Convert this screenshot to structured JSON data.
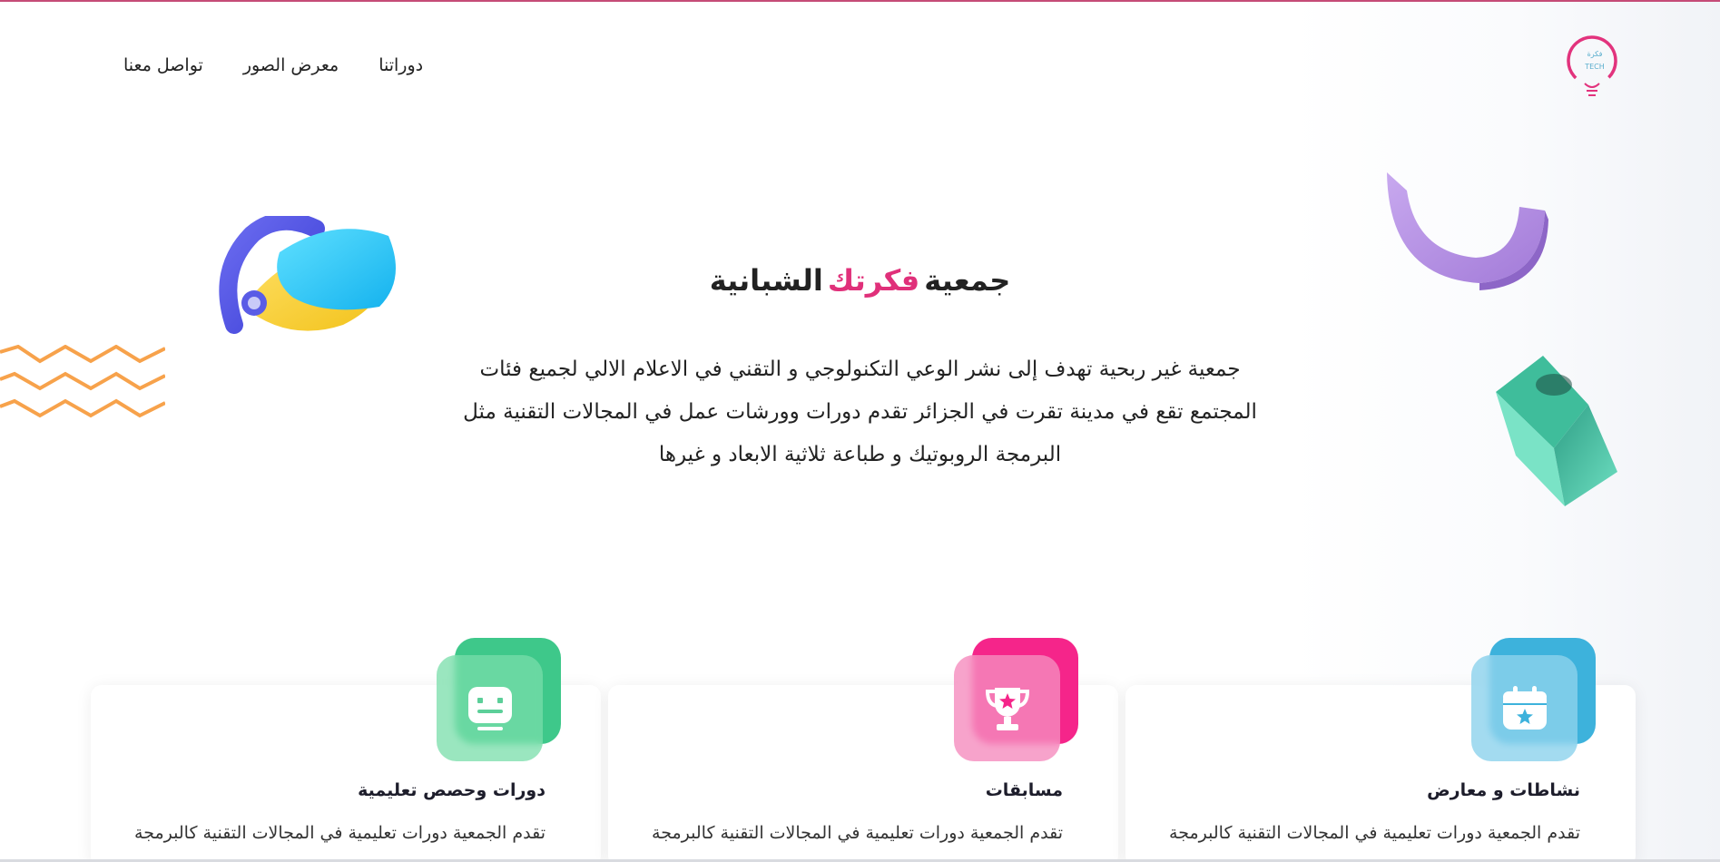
{
  "nav": {
    "items": [
      {
        "label": "تواصل معنا"
      },
      {
        "label": "معرض الصور"
      },
      {
        "label": "دوراتنا"
      }
    ]
  },
  "logo": {
    "text_top": "فكرة",
    "text_bottom": "TECH"
  },
  "hero": {
    "title_part1": "جمعية",
    "title_accent": "فكرتك",
    "title_part2": "الشبانية",
    "description": "جمعية غير ربحية تهدف إلى نشر الوعي التكنولوجي و التقني في الاعلام الالي لجميع فئات المجتمع تقع في مدينة تقرت في الجزائر تقدم دورات وورشات عمل في المجالات التقنية مثل البرمجة الروبوتيك و طباعة ثلاثية الابعاد و غيرها"
  },
  "cards": [
    {
      "title": "نشاطات و معارض",
      "text": "تقدم الجمعية دورات تعليمية في المجالات التقنية كالبرمجة",
      "icon": "calendar-star-icon",
      "color": "#3db2dc"
    },
    {
      "title": "مسابقات",
      "text": "تقدم الجمعية دورات تعليمية في المجالات التقنية كالبرمجة",
      "icon": "trophy-icon",
      "color": "#f5258a"
    },
    {
      "title": "دورات وحصص تعليمية",
      "text": "تقدم الجمعية دورات تعليمية في المجالات التقنية كالبرمجة",
      "icon": "chat-bubble-icon",
      "color": "#3ec88a"
    }
  ],
  "colors": {
    "accent_pink": "#e0307a",
    "top_border": "#c54b77",
    "zigzag": "#f7a24b",
    "arc_purple": "#b692e3",
    "cube_teal": "#49c9a6"
  }
}
